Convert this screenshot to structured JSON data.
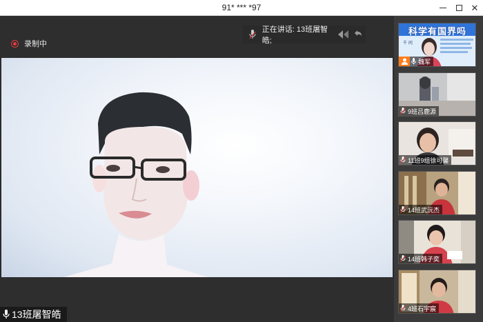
{
  "window": {
    "title": "91* *** *97"
  },
  "recording": {
    "label": "录制中"
  },
  "speaking": {
    "label": "正在讲话: 13班屠智皓;"
  },
  "current_speaker": {
    "name": "13班屠智皓"
  },
  "thumbnails": [
    {
      "name": "魏军",
      "banner": "科学有国界吗"
    },
    {
      "name": "9班吕鹿源"
    },
    {
      "name": "11班9组徐可馨"
    },
    {
      "name": "14班武沅杰"
    },
    {
      "name": "14班韩子奕"
    },
    {
      "name": "4班石宇宸"
    }
  ],
  "colors": {
    "record_red": "#e23b3b",
    "host_badge": "#ff7d1a",
    "banner_blue": "#2f74d8"
  }
}
